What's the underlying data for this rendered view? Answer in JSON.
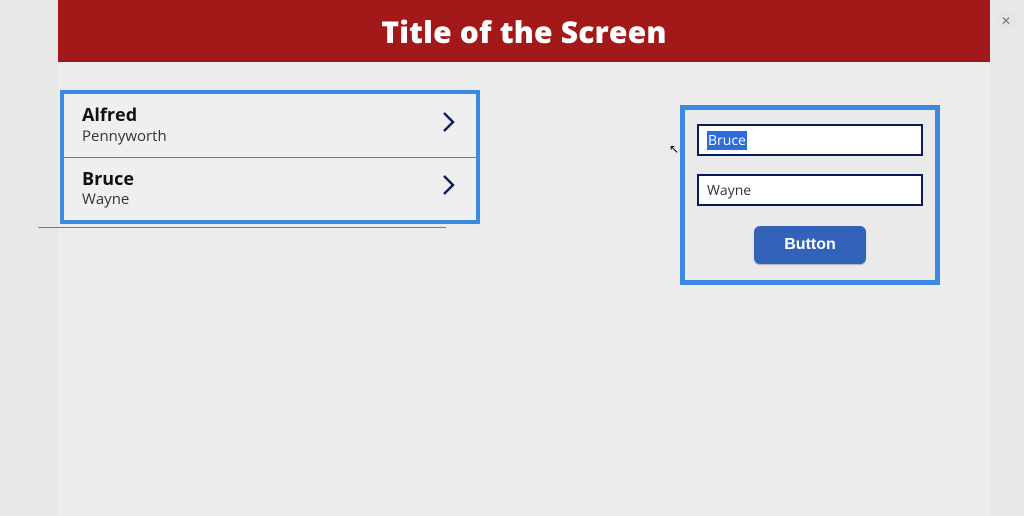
{
  "header": {
    "title": "Title of the Screen"
  },
  "list": {
    "items": [
      {
        "first": "Alfred",
        "last": "Pennyworth"
      },
      {
        "first": "Bruce",
        "last": "Wayne"
      }
    ]
  },
  "form": {
    "first_value": "Bruce",
    "last_value": "Wayne",
    "button_label": "Button"
  }
}
